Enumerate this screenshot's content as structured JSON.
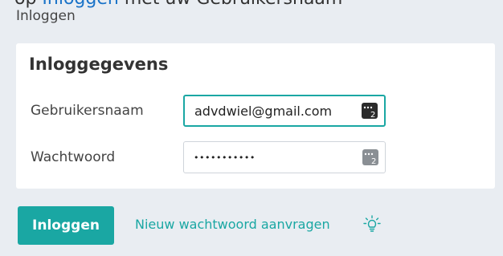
{
  "cropped_header": {
    "prefix": "op ",
    "link": "Inloggen",
    "suffix": " met uw Gebruikersnaam"
  },
  "page": {
    "title": "Inloggen"
  },
  "card": {
    "title": "Inloggegevens"
  },
  "form": {
    "username_label": "Gebruikersnaam",
    "username_value": "advdwiel@gmail.com",
    "password_label": "Wachtwoord",
    "password_value": "•••••••••••",
    "login_button": "Inloggen",
    "reset_link": "Nieuw wachtwoord aanvragen"
  },
  "colors": {
    "accent": "#1aa7a3",
    "background": "#e9edf2"
  },
  "icons": {
    "password_manager": "password-manager-icon",
    "hint": "lightbulb-icon"
  }
}
